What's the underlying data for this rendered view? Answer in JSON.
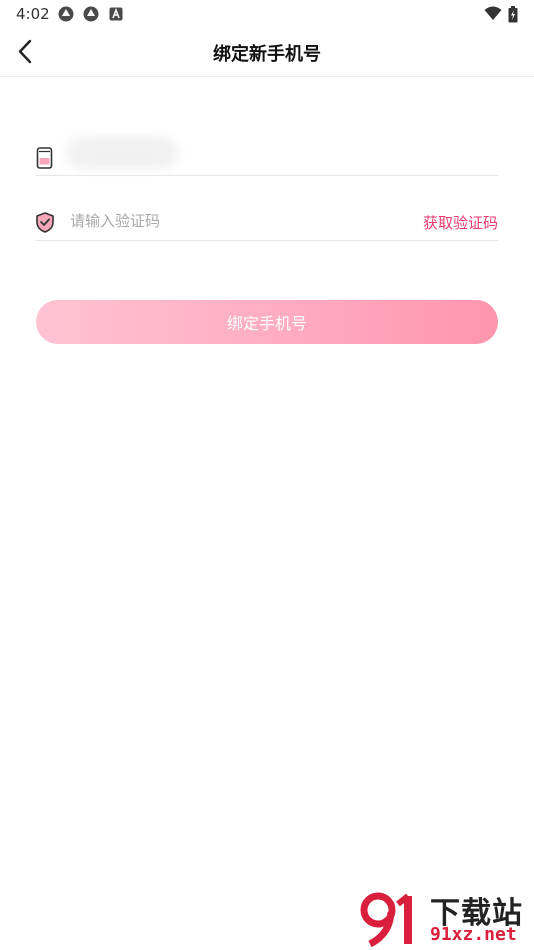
{
  "status_bar": {
    "time": "4:02",
    "icons": [
      "aperture-icon",
      "aperture-icon",
      "a-box-icon",
      "wifi-icon",
      "battery-charging-icon"
    ]
  },
  "header": {
    "back_icon": "chevron-left-icon",
    "title": "绑定新手机号"
  },
  "form": {
    "phone": {
      "icon": "phone-icon",
      "value": ""
    },
    "code": {
      "icon": "shield-check-icon",
      "placeholder": "请输入验证码",
      "get_code_label": "获取验证码"
    },
    "submit_label": "绑定手机号"
  },
  "watermark": {
    "logo_text": "91",
    "title": "下载站",
    "domain": "91xz.net"
  },
  "colors": {
    "accent": "#ee3a6d",
    "button_gradient_start": "#ffc3d3",
    "button_gradient_end": "#ff95ad",
    "divider": "#e6e6e6"
  }
}
